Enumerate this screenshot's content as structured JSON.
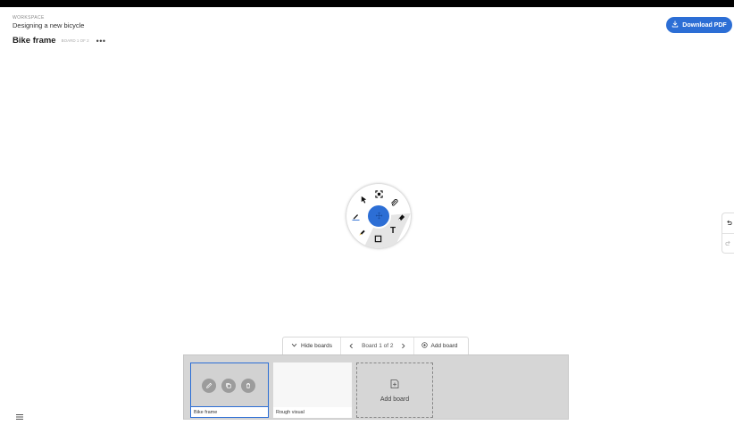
{
  "header": {
    "workspace_label": "WORKSPACE",
    "project_title": "Designing a new bicycle",
    "board_title": "Bike frame",
    "board_count": "BOARD 1 OF 2",
    "more_label": "•••"
  },
  "toolbar": {
    "download_label": "Download PDF"
  },
  "tool_wheel": {
    "tools": [
      "select-icon",
      "fit-screen-icon",
      "attach-icon",
      "eraser-icon",
      "text-icon",
      "shape-icon",
      "marker-icon",
      "pen-icon"
    ],
    "text_tool_label": "T",
    "accent_color": "#2c6ed5"
  },
  "board_nav": {
    "hide_label": "Hide boards",
    "pager_label": "Board 1 of 2",
    "add_label": "Add board"
  },
  "boards": {
    "items": [
      {
        "label": "Bike frame"
      },
      {
        "label": "Rough visual"
      }
    ],
    "add_label": "Add board"
  }
}
